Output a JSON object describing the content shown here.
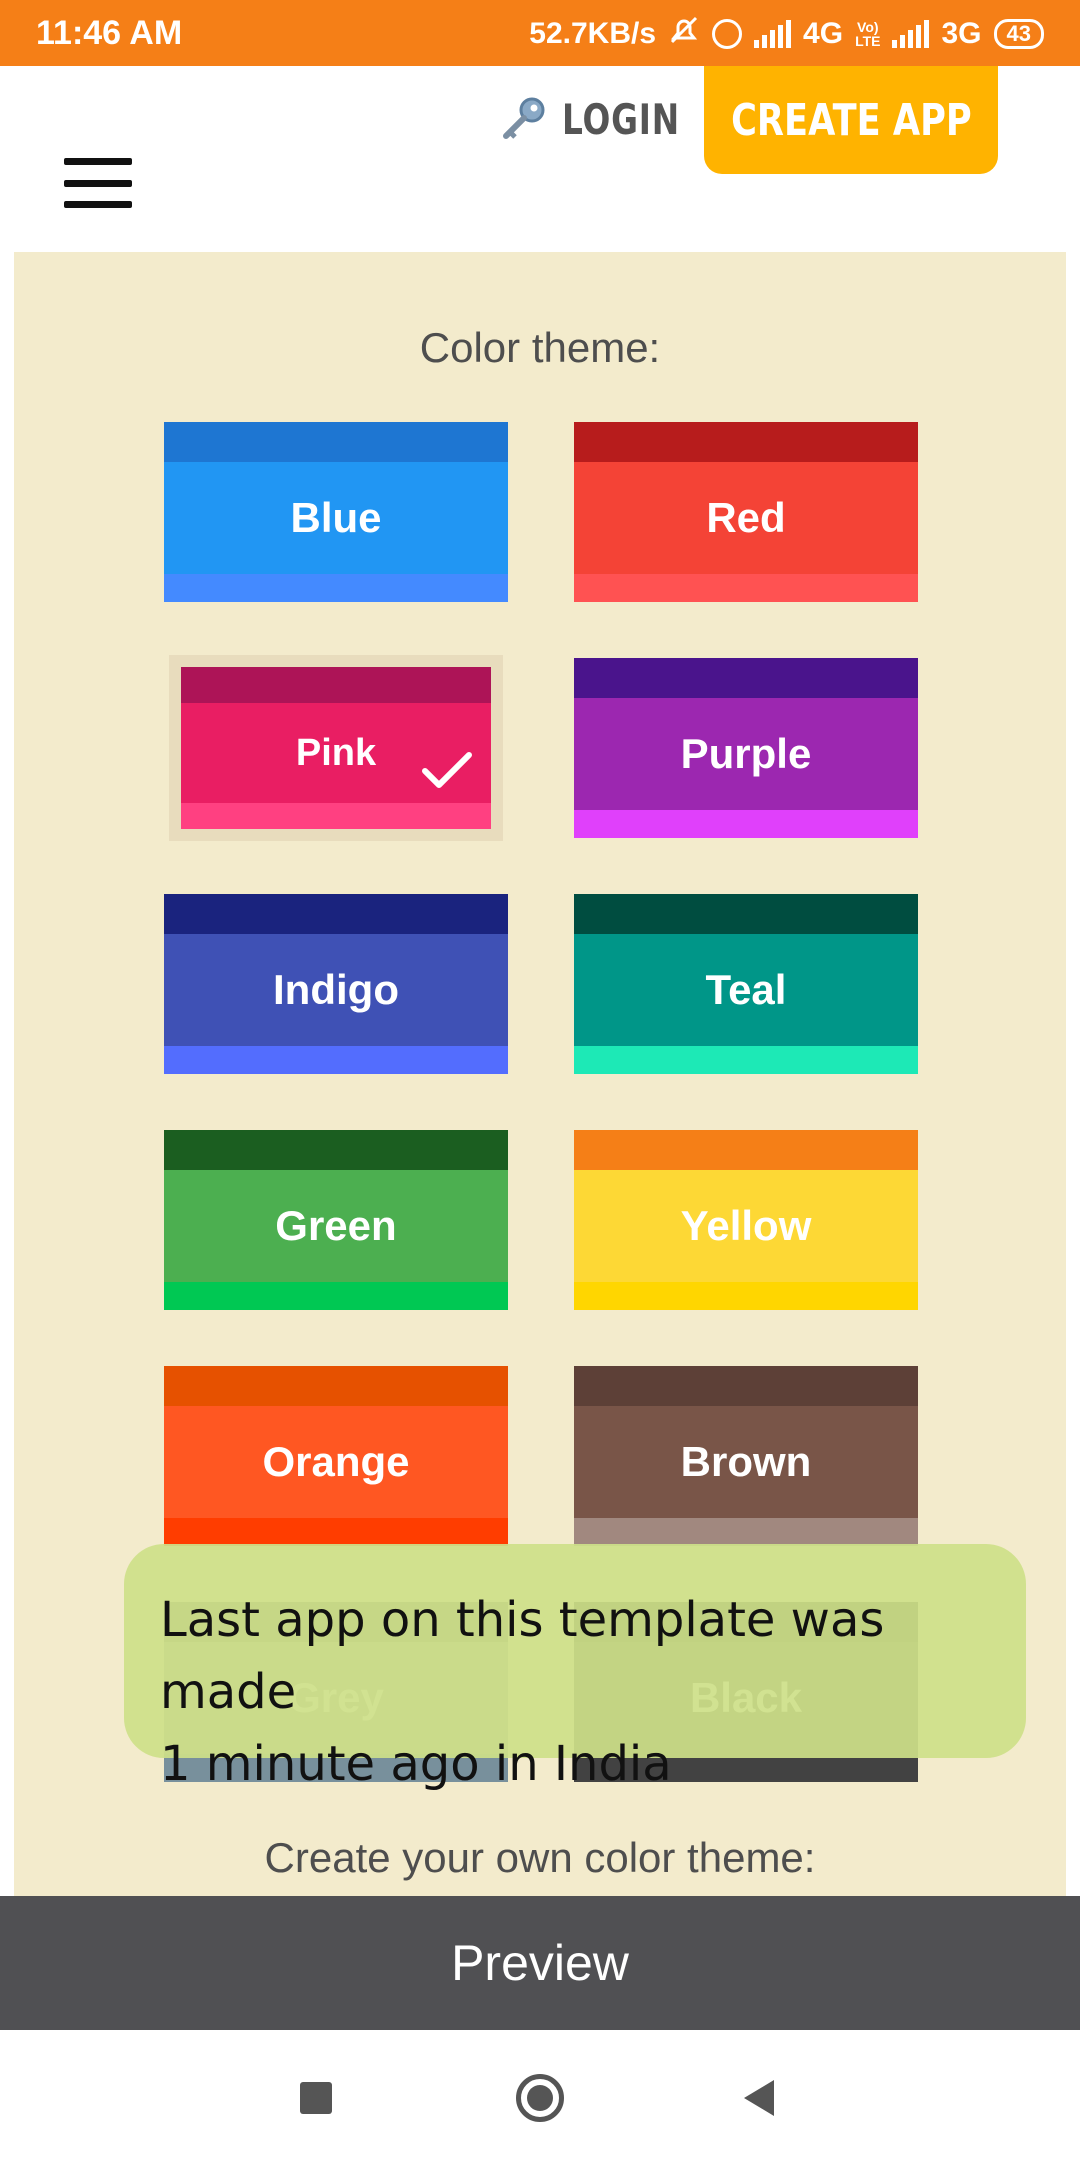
{
  "status_bar": {
    "time": "11:46 AM",
    "speed": "52.7KB/s",
    "network1": "4G",
    "volte_top": "Vo)",
    "volte_bottom": "LTE",
    "network2": "3G",
    "battery": "43"
  },
  "header": {
    "login_label": "LOGIN",
    "create_label": "CREATE APP"
  },
  "color_theme": {
    "title": "Color theme:",
    "selected": "Pink",
    "themes": [
      {
        "label": "Blue",
        "top": "#1e76d2",
        "mid": "#2196f3",
        "bottom": "#448aff"
      },
      {
        "label": "Red",
        "top": "#b71c1c",
        "mid": "#f44336",
        "bottom": "#ff5252"
      },
      {
        "label": "Pink",
        "top": "#ad1457",
        "mid": "#e91e63",
        "bottom": "#ff4081"
      },
      {
        "label": "Purple",
        "top": "#4a148c",
        "mid": "#9c27b0",
        "bottom": "#e040fb"
      },
      {
        "label": "Indigo",
        "top": "#1a237e",
        "mid": "#3f51b5",
        "bottom": "#536dfe"
      },
      {
        "label": "Teal",
        "top": "#004d40",
        "mid": "#009688",
        "bottom": "#1de9b6"
      },
      {
        "label": "Green",
        "top": "#1b5e20",
        "mid": "#4caf50",
        "bottom": "#00c853"
      },
      {
        "label": "Yellow",
        "top": "#f57f17",
        "mid": "#fdd835",
        "bottom": "#ffd600"
      },
      {
        "label": "Orange",
        "top": "#e65100",
        "mid": "#ff5722",
        "bottom": "#ff3d00"
      },
      {
        "label": "Brown",
        "top": "#5d4037",
        "mid": "#795548",
        "bottom": "#a1887f"
      },
      {
        "label": "Grey",
        "top": "#616161",
        "mid": "#9e9e9e",
        "bottom": "#78909c"
      },
      {
        "label": "Black",
        "top": "#212121",
        "mid": "#3a3a3a",
        "bottom": "#424242"
      }
    ]
  },
  "custom_theme": {
    "title": "Create your own color theme:"
  },
  "toast": {
    "line1": "Last app on this template was made",
    "line2": "1 minute ago in India"
  },
  "preview": {
    "label": "Preview"
  }
}
